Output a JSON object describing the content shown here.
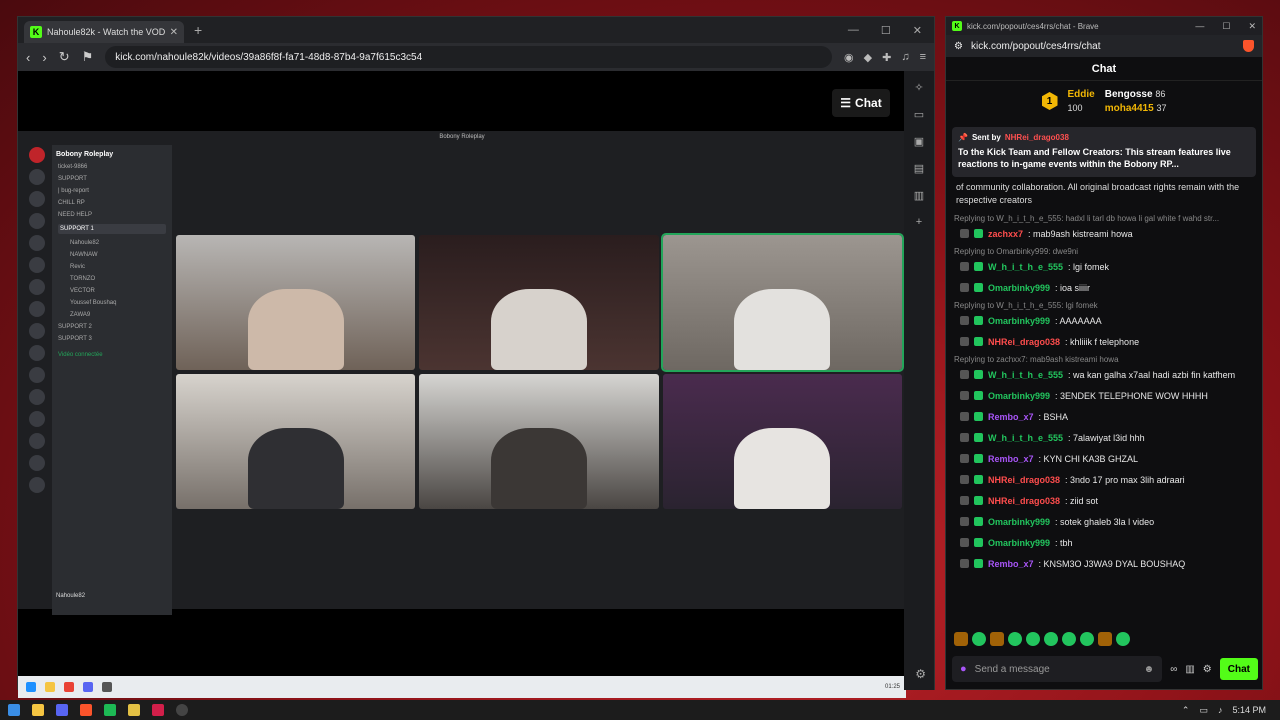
{
  "browser": {
    "tab_title": "Nahoule82k - Watch the VOD",
    "url": "kick.com/nahoule82k/videos/39a86f8f-fa71-48d8-87b4-9a7f615c3c54",
    "chat_button": "Chat"
  },
  "discord": {
    "window_title": "Bobony Roleplay",
    "server_name": "Bobony Roleplay",
    "channels": [
      "ticket-9866",
      "SUPPORT",
      "| bug-report",
      "CHILL RP",
      "NEED HELP",
      "SUPPORT 1",
      "SUPPORT 2",
      "SUPPORT 3"
    ],
    "members": [
      "Nahoule82",
      "NAWNAW",
      "Revic",
      "TORNZO",
      "VECTOR",
      "Youssef Boushaq",
      "ZAWA9"
    ],
    "voice_status": "Vidéo connectée",
    "username": "Nahoule82",
    "clock": "01:25"
  },
  "popout": {
    "window_title": "kick.com/popout/ces4rrs/chat - Brave",
    "url": "kick.com/popout/ces4rrs/chat",
    "header": "Chat",
    "leaderboard": [
      {
        "rank": "1",
        "name": "Eddie",
        "points": "100",
        "color": "#f2b705"
      },
      {
        "rank": "",
        "name": "Bengosse",
        "points": "86",
        "color": "#ffffff"
      },
      {
        "rank": "",
        "name": "moha4415",
        "points": "37",
        "color": "#f2b705"
      }
    ],
    "pinned": {
      "sent_by_label": "Sent by",
      "sent_by_user": "NHRei_drago038",
      "text": "To the Kick Team and Fellow Creators: This stream features live reactions to in-game events within the Bobony RP...",
      "tail": "of community collaboration. All original broadcast rights remain with the respective creators"
    },
    "messages": [
      {
        "reply": "Replying to W_h_i_t_h_e_555: hadxl li tarl db howa li gal white f wahd str...",
        "user": "zachxx7",
        "color": "#ff4d4d",
        "text": ": mab9ash kistreami howa"
      },
      {
        "reply": "Replying to Omarbinky999: dwe9ni",
        "user": "W_h_i_t_h_e_555",
        "color": "#22c55e",
        "text": ": lgi fomek"
      },
      {
        "reply": "",
        "user": "Omarbinky999",
        "color": "#22c55e",
        "text": ": ioa siiiir"
      },
      {
        "reply": "Replying to W_h_i_t_h_e_555: lgi fomek",
        "user": "Omarbinky999",
        "color": "#22c55e",
        "text": ": AAAAAAA"
      },
      {
        "reply": "",
        "user": "NHRei_drago038",
        "color": "#ff4d4d",
        "text": ": khliiik f telephone"
      },
      {
        "reply": "Replying to zachxx7: mab9ash kistreami howa",
        "user": "W_h_i_t_h_e_555",
        "color": "#22c55e",
        "text": ": wa kan galha x7aal hadi azbi fin katfhem"
      },
      {
        "reply": "",
        "user": "Omarbinky999",
        "color": "#22c55e",
        "text": ": 3ENDEK TELEPHONE WOW HHHH"
      },
      {
        "reply": "",
        "user": "Rembo_x7",
        "color": "#a855f7",
        "text": ": BSHA"
      },
      {
        "reply": "",
        "user": "W_h_i_t_h_e_555",
        "color": "#22c55e",
        "text": ": 7alawiyat l3id hhh"
      },
      {
        "reply": "",
        "user": "Rembo_x7",
        "color": "#a855f7",
        "text": ": KYN CHI KA3B GHZAL"
      },
      {
        "reply": "",
        "user": "NHRei_drago038",
        "color": "#ff4d4d",
        "text": ": 3ndo 17 pro max 3lih adraari"
      },
      {
        "reply": "",
        "user": "NHRei_drago038",
        "color": "#ff4d4d",
        "text": ": ziid sot"
      },
      {
        "reply": "",
        "user": "Omarbinky999",
        "color": "#22c55e",
        "text": ": sotek ghaleb 3la l video"
      },
      {
        "reply": "",
        "user": "Omarbinky999",
        "color": "#22c55e",
        "text": ": tbh"
      },
      {
        "reply": "",
        "user": "Rembo_x7",
        "color": "#a855f7",
        "text": ": KNSM3O J3WA9 DYAL BOUSHAQ"
      }
    ],
    "composer_placeholder": "Send a message",
    "send_label": "Chat"
  },
  "taskbar": {
    "time": "5:14 PM"
  },
  "colors": {
    "kick_green": "#53fc18",
    "discord_bg": "#1e1f22"
  }
}
